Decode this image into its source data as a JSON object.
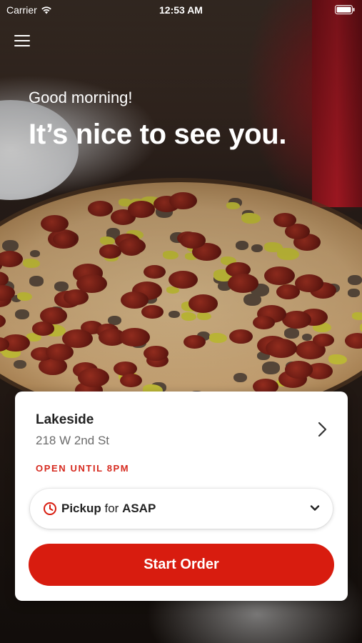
{
  "status_bar": {
    "carrier": "Carrier",
    "time": "12:53 AM"
  },
  "header": {
    "greeting": "Good morning!",
    "headline": "It’s nice to see you."
  },
  "location_card": {
    "name": "Lakeside",
    "address": "218 W 2nd St",
    "hours": "OPEN UNTIL 8PM",
    "order_mode": "Pickup",
    "order_for_word": "for",
    "order_time": "ASAP",
    "start_order_label": "Start Order"
  },
  "colors": {
    "accent": "#d81c0f",
    "hours_text": "#d62a1f"
  },
  "icons": [
    "wifi-icon",
    "battery-icon",
    "menu-icon",
    "chevron-right-icon",
    "clock-icon",
    "chevron-down-icon"
  ]
}
